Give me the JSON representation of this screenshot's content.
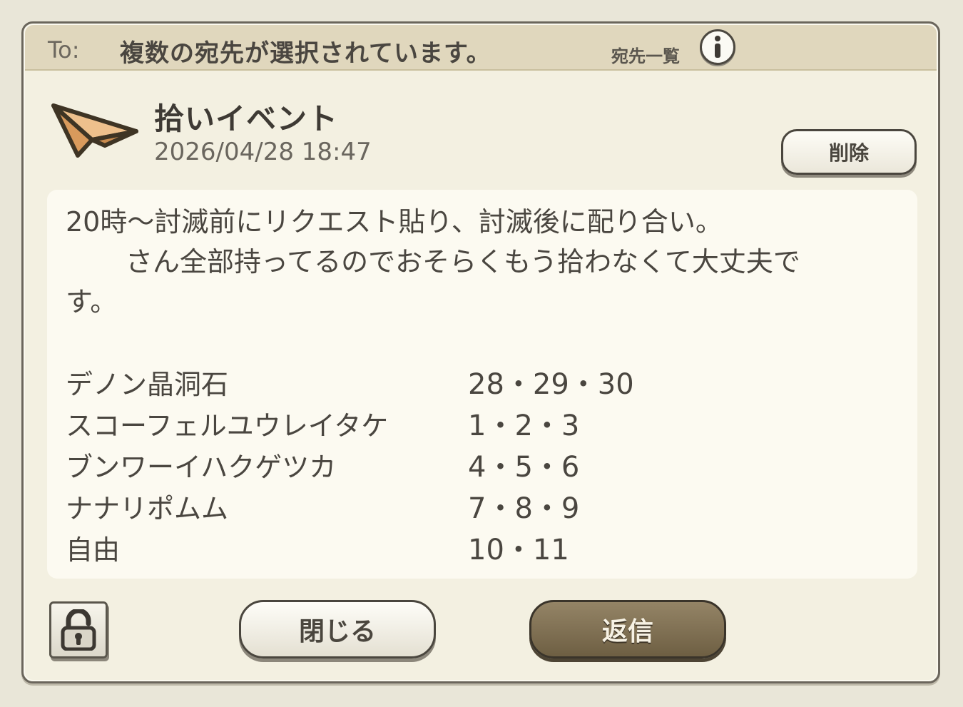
{
  "header": {
    "to_label": "To:",
    "recipients_text": "複数の宛先が選択されています。",
    "recipient_list_label": "宛先一覧"
  },
  "mail": {
    "subject": "拾いイベント",
    "timestamp": "2026/04/28 18:47",
    "delete_label": "削除",
    "body_lines": [
      "20時〜討滅前にリクエスト貼り、討滅後に配り合い。",
      "さん全部持ってるのでおそらくもう拾わなくて大丈夫で",
      "す。"
    ],
    "items": [
      {
        "name": "デノン晶洞石",
        "dates": "28・29・30"
      },
      {
        "name": "スコーフェルユウレイタケ",
        "dates": "1・2・3"
      },
      {
        "name": "ブンワーイハクゲツカ",
        "dates": "4・5・6"
      },
      {
        "name": "ナナリポムム",
        "dates": "7・8・9"
      },
      {
        "name": "自由",
        "dates": "10・11"
      }
    ]
  },
  "footer": {
    "close_label": "閉じる",
    "reply_label": "返信"
  },
  "colors": {
    "header_bar": "#e0d7bd",
    "window_bg": "#f3f0e1",
    "body_bg": "#fcfaf1",
    "reply_button": "#7e6f52",
    "plane_fill": "#e7b27d",
    "plane_outline": "#3e3424"
  },
  "icons": {
    "info": "info-icon",
    "mail": "paper-plane-icon",
    "lock": "unlocked-padlock-icon"
  }
}
